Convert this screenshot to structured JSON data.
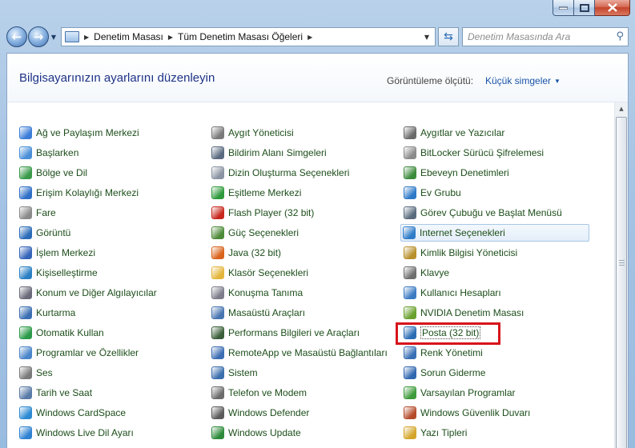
{
  "window": {
    "breadcrumb": [
      "Denetim Masası",
      "Tüm Denetim Masası Öğeleri"
    ],
    "search_placeholder": "Denetim Masasında Ara"
  },
  "header": {
    "title": "Bilgisayarınızın ayarlarını düzenleyin",
    "view_label": "Görüntüleme ölçütü:",
    "view_value": "Küçük simgeler"
  },
  "columns": [
    [
      {
        "label": "Ağ ve Paylaşım Merkezi",
        "icon": "network-icon",
        "color": "#3b7dd8"
      },
      {
        "label": "Başlarken",
        "icon": "start-icon",
        "color": "#4a8fd8"
      },
      {
        "label": "Bölge ve Dil",
        "icon": "globe-clock-icon",
        "color": "#3a9a4a"
      },
      {
        "label": "Erişim Kolaylığı Merkezi",
        "icon": "accessibility-icon",
        "color": "#2f6fc7"
      },
      {
        "label": "Fare",
        "icon": "mouse-icon",
        "color": "#8a8a8a"
      },
      {
        "label": "Görüntü",
        "icon": "monitor-icon",
        "color": "#2b6cb8"
      },
      {
        "label": "İşlem Merkezi",
        "icon": "flag-icon",
        "color": "#3565b9"
      },
      {
        "label": "Kişiselleştirme",
        "icon": "personalize-icon",
        "color": "#2a7fc3"
      },
      {
        "label": "Konum ve Diğer Algılayıcılar",
        "icon": "sensor-icon",
        "color": "#6a6a7a"
      },
      {
        "label": "Kurtarma",
        "icon": "recovery-icon",
        "color": "#3b6fb2"
      },
      {
        "label": "Otomatik Kullan",
        "icon": "autoplay-icon",
        "color": "#2b9a48"
      },
      {
        "label": "Programlar ve Özellikler",
        "icon": "programs-icon",
        "color": "#4a86c9"
      },
      {
        "label": "Ses",
        "icon": "speaker-icon",
        "color": "#7a7a7a"
      },
      {
        "label": "Tarih ve Saat",
        "icon": "clock-icon",
        "color": "#5a7ba8"
      },
      {
        "label": "Windows CardSpace",
        "icon": "cardspace-icon",
        "color": "#2d8ad3"
      },
      {
        "label": "Windows Live Dil Ayarı",
        "icon": "live-globe-icon",
        "color": "#2f82d2"
      }
    ],
    [
      {
        "label": "Aygıt Yöneticisi",
        "icon": "device-manager-icon",
        "color": "#7a7a7a"
      },
      {
        "label": "Bildirim Alanı Simgeleri",
        "icon": "notification-icon",
        "color": "#5a6b80"
      },
      {
        "label": "Dizin Oluşturma Seçenekleri",
        "icon": "indexing-icon",
        "color": "#8a93a2"
      },
      {
        "label": "Eşitleme Merkezi",
        "icon": "sync-icon",
        "color": "#2e9a3c"
      },
      {
        "label": "Flash Player (32 bit)",
        "icon": "flash-icon",
        "color": "#c8281e"
      },
      {
        "label": "Güç Seçenekleri",
        "icon": "power-icon",
        "color": "#4d8b3a"
      },
      {
        "label": "Java (32 bit)",
        "icon": "java-icon",
        "color": "#d9631c"
      },
      {
        "label": "Klasör Seçenekleri",
        "icon": "folder-icon",
        "color": "#e3b53a"
      },
      {
        "label": "Konuşma Tanıma",
        "icon": "microphone-icon",
        "color": "#7c7c8a"
      },
      {
        "label": "Masaüstü Araçları",
        "icon": "gadgets-icon",
        "color": "#4775b0"
      },
      {
        "label": "Performans Bilgileri ve Araçları",
        "icon": "performance-icon",
        "color": "#3a5f3a"
      },
      {
        "label": "RemoteApp ve Masaüstü Bağlantıları",
        "icon": "remoteapp-icon",
        "color": "#3d6db3"
      },
      {
        "label": "Sistem",
        "icon": "system-icon",
        "color": "#3c6fae"
      },
      {
        "label": "Telefon ve Modem",
        "icon": "phone-icon",
        "color": "#6b6b6b"
      },
      {
        "label": "Windows Defender",
        "icon": "defender-icon",
        "color": "#5b5b5b"
      },
      {
        "label": "Windows Update",
        "icon": "update-icon",
        "color": "#2d8a3a"
      }
    ],
    [
      {
        "label": "Aygıtlar ve Yazıcılar",
        "icon": "printer-icon",
        "color": "#6a6a6a"
      },
      {
        "label": "BitLocker Sürücü Şifrelemesi",
        "icon": "bitlocker-icon",
        "color": "#8a8a8a"
      },
      {
        "label": "Ebeveyn Denetimleri",
        "icon": "parental-icon",
        "color": "#3c8a3c"
      },
      {
        "label": "Ev Grubu",
        "icon": "homegroup-icon",
        "color": "#2f79c7"
      },
      {
        "label": "Görev Çubuğu ve Başlat Menüsü",
        "icon": "taskbar-icon",
        "color": "#5a6b7d"
      },
      {
        "label": "Internet Seçenekleri",
        "icon": "internet-icon",
        "color": "#2f7cc9"
      },
      {
        "label": "Kimlik Bilgisi Yöneticisi",
        "icon": "credential-icon",
        "color": "#b8902c"
      },
      {
        "label": "Klavye",
        "icon": "keyboard-icon",
        "color": "#6f6f6f"
      },
      {
        "label": "Kullanıcı Hesapları",
        "icon": "users-icon",
        "color": "#3c7bc2"
      },
      {
        "label": "NVIDIA Denetim Masası",
        "icon": "nvidia-icon",
        "color": "#6aa02d"
      },
      {
        "label": "Posta (32 bit)",
        "icon": "mail-icon",
        "color": "#2c6cb5"
      },
      {
        "label": "Renk Yönetimi",
        "icon": "color-icon",
        "color": "#3a6fb5"
      },
      {
        "label": "Sorun Giderme",
        "icon": "troubleshoot-icon",
        "color": "#3067b0"
      },
      {
        "label": "Varsayılan Programlar",
        "icon": "default-programs-icon",
        "color": "#3e9a3a"
      },
      {
        "label": "Windows Güvenlik Duvarı",
        "icon": "firewall-icon",
        "color": "#b54b2a"
      },
      {
        "label": "Yazı Tipleri",
        "icon": "fonts-icon",
        "color": "#d4a52a"
      }
    ]
  ]
}
